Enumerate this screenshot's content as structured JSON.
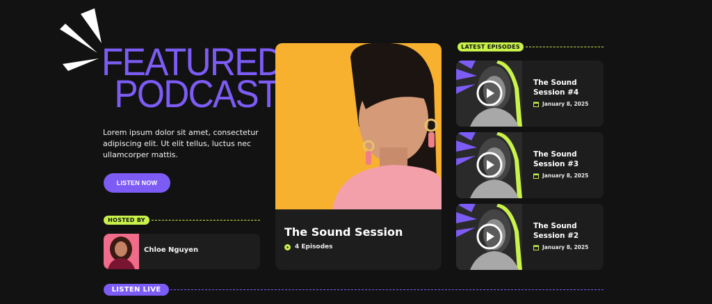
{
  "hero": {
    "title_line1": "FEATURED",
    "title_line2": "PODCAST",
    "description": "Lorem ipsum dolor sit amet, consectetur adipiscing elit. Ut elit tellus, luctus nec ullamcorper mattis.",
    "cta_label": "LISTEN NOW"
  },
  "host": {
    "section_label": "HOSTED BY",
    "name": "Chloe Nguyen"
  },
  "featured": {
    "title": "The Sound Session",
    "episodes": "4 Episodes"
  },
  "latest": {
    "section_label": "LATEST EPISODES",
    "episodes": [
      {
        "title": "The Sound Session #4",
        "date": "January 8, 2025"
      },
      {
        "title": "The Sound Session #3",
        "date": "January 8, 2025"
      },
      {
        "title": "The Sound Session #2",
        "date": "January 8, 2025"
      }
    ]
  },
  "live": {
    "label": "LISTEN LIVE"
  },
  "colors": {
    "accent": "#7c5cf5",
    "lime": "#c9f24a",
    "background": "#121212",
    "card": "#1d1d1d"
  }
}
